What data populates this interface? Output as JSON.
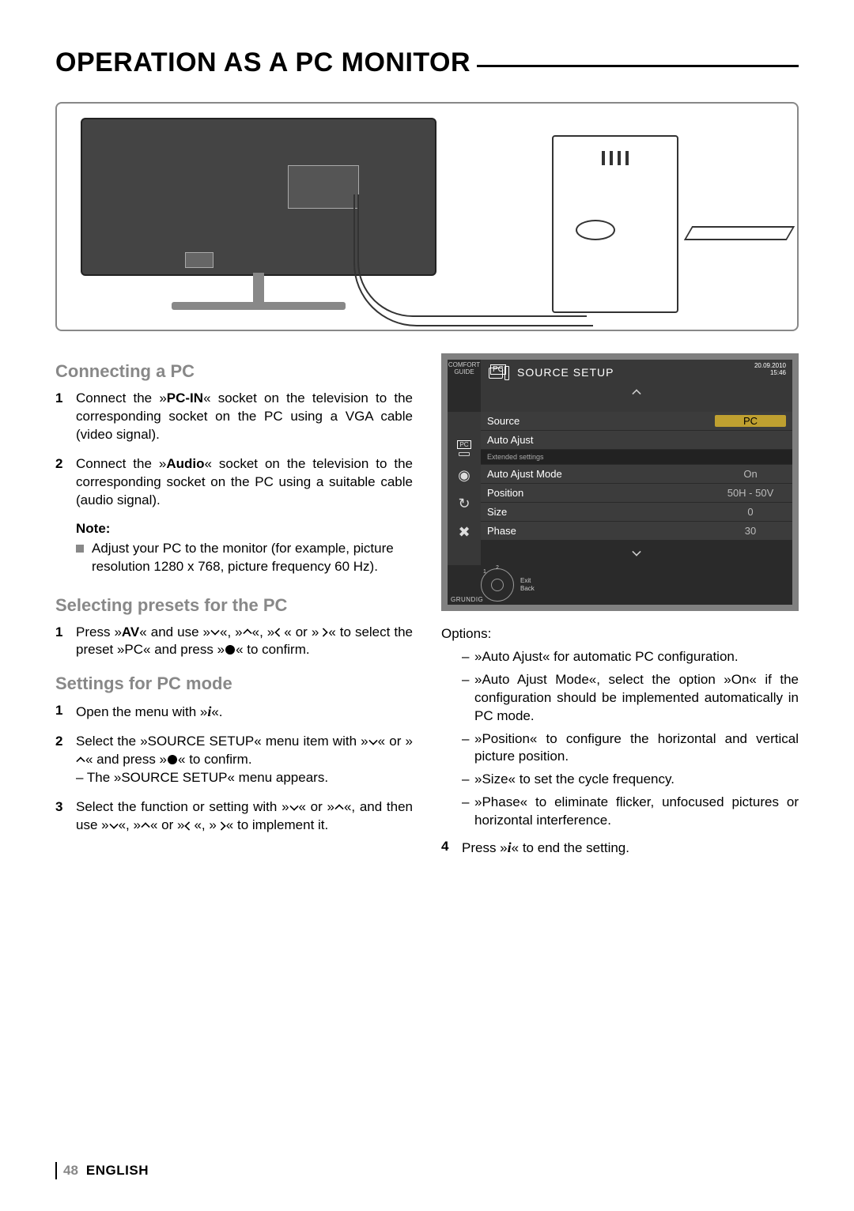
{
  "page": {
    "title": "OPERATION AS A PC MONITOR",
    "page_number": "48",
    "language": "ENGLISH"
  },
  "sections": {
    "connecting": {
      "heading": "Connecting a PC",
      "steps": {
        "1": {
          "num": "1",
          "pre": "Connect the »",
          "bold": "PC-IN",
          "post": "« socket on the television to the corresponding socket on the PC using a VGA cable (video signal)."
        },
        "2": {
          "num": "2",
          "pre": "Connect the »",
          "bold": "Audio",
          "post": "« socket on the television to the corresponding socket on the PC using a suitable cable (audio signal)."
        }
      },
      "note_label": "Note:",
      "note_body": "Adjust your PC to the monitor (for example, picture resolution 1280 x 768, picture frequency 60 Hz)."
    },
    "presets": {
      "heading": "Selecting presets for the PC",
      "steps": {
        "1": {
          "num": "1",
          "pre": "Press »",
          "bold": "AV",
          "mid": "« and use »",
          "end": "« to select the preset »PC« and press »",
          "tail": "« to confirm."
        }
      }
    },
    "settings": {
      "heading": "Settings for PC mode",
      "steps": {
        "1": {
          "num": "1",
          "body": "Open the menu with »",
          "tail": "«."
        },
        "2": {
          "num": "2",
          "body_a": " Select the »SOURCE SETUP« menu item with »",
          "body_b": "« or »",
          "body_c": "« and press »",
          "body_d": "« to confirm.",
          "sub": "– The »SOURCE SETUP« menu appears."
        },
        "3": {
          "num": "3",
          "body_a": "Select the function or setting with »",
          "body_b": "« or »",
          "body_c": "«, and then use »",
          "body_d": "«, »",
          "body_e": "« or »",
          "body_f": "«, »",
          "body_g": "« to implement it."
        },
        "4": {
          "num": "4",
          "body_a": "Press »",
          "body_b": "« to end the setting."
        }
      }
    },
    "options": {
      "label": "Options:",
      "items": [
        "»Auto Ajust« for automatic PC configuration.",
        "»Auto Ajust Mode«, select the option »On« if the configuration should be implemented automatically in PC mode.",
        "»Position« to configure the horizontal and vertical picture position.",
        "»Size« to set the cycle frequency.",
        "»Phase« to eliminate flicker, unfocused pictures or horizontal interference."
      ]
    }
  },
  "osd": {
    "comfort": "COMFORT GUIDE",
    "pc_label": "PC",
    "title": "SOURCE SETUP",
    "date": "20.09.2010",
    "time": "15:46",
    "rows": [
      {
        "k": "Source",
        "v": "PC",
        "sel": true
      },
      {
        "k": "Auto Ajust",
        "v": ""
      }
    ],
    "ext_header": "Extended settings",
    "ext_rows": [
      {
        "k": "Auto Ajust Mode",
        "v": "On"
      },
      {
        "k": "Position",
        "v": "50H - 50V"
      },
      {
        "k": "Size",
        "v": "0"
      },
      {
        "k": "Phase",
        "v": "30"
      }
    ],
    "nav": {
      "exit": "Exit",
      "back": "Back",
      "n1": "1",
      "n2": "2"
    },
    "brand": "GRUNDIG"
  }
}
